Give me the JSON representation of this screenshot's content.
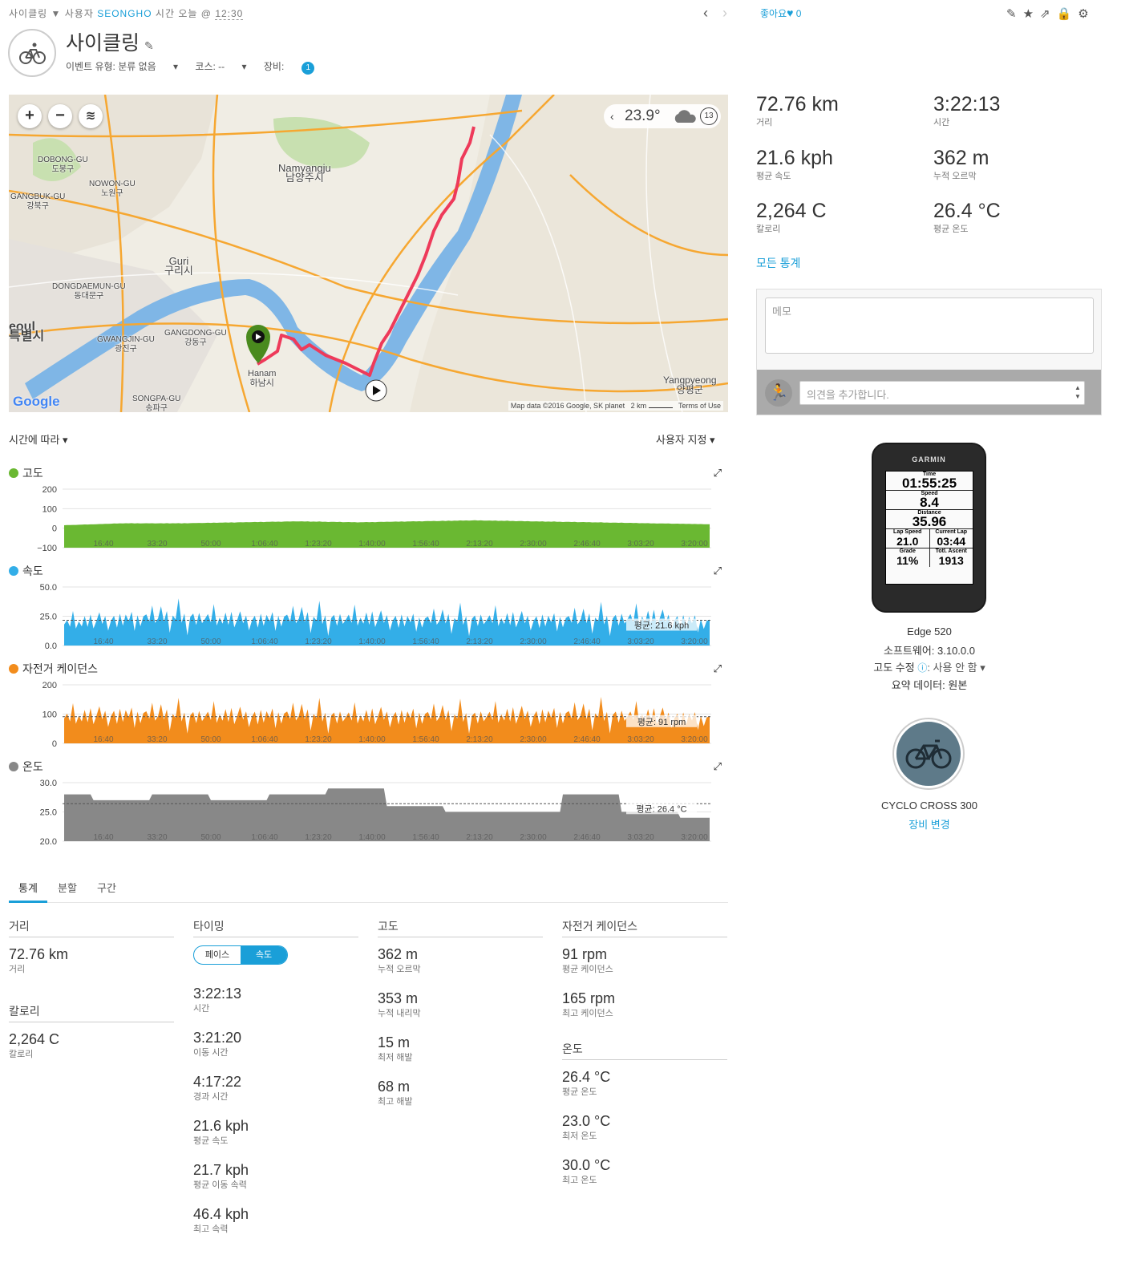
{
  "breadcrumb": {
    "section": "사이클링",
    "arrow": "▼",
    "by": "사용자",
    "user": "SEONGHO",
    "time_prefix": "시간",
    "day": "오늘",
    "at": "@",
    "time": "12:30"
  },
  "activity": {
    "title": "사이클링",
    "event_type": "이벤트 유형: 분류 없음",
    "course": "코스: --",
    "gear_label": "장비:",
    "gear_count": "1"
  },
  "social": {
    "like_label": "좋아요",
    "like_count": "0"
  },
  "map": {
    "temperature": "23.9°",
    "weather_icon": "cloud-icon",
    "wind": "13",
    "attribution": "Map data ©2016 Google, SK planet",
    "scale": "2 km",
    "terms": "Terms of Use",
    "logo": "Google",
    "labels": [
      {
        "en": "Namyangju",
        "ko": "남양주시"
      },
      {
        "en": "Guri",
        "ko": "구리시"
      },
      {
        "en": "DOBONG-GU",
        "ko": "도봉구"
      },
      {
        "en": "NOWON-GU",
        "ko": "노원구"
      },
      {
        "en": "GANGBUK-GU",
        "ko": "강북구"
      },
      {
        "en": "DONGDAEMUN-GU",
        "ko": "동대문구"
      },
      {
        "en": "GWANGJIN-GU",
        "ko": "광진구"
      },
      {
        "en": "GANGDONG-GU",
        "ko": "강동구"
      },
      {
        "en": "Hanam",
        "ko": "하남시"
      },
      {
        "en": "SONGPA-GU",
        "ko": "송파구"
      },
      {
        "en": "Yangpyeong",
        "ko": "양평군"
      },
      {
        "en": "eoul",
        "ko": "특별시"
      }
    ]
  },
  "controls": {
    "x_axis": "시간에 따라",
    "custom": "사용자 지정"
  },
  "charts": [
    {
      "name": "고도",
      "color": "#6ab832",
      "yticks": [
        "200",
        "100",
        "0",
        "−100"
      ],
      "avg_label": ""
    },
    {
      "name": "속도",
      "color": "#33aee8",
      "yticks": [
        "50.0",
        "25.0",
        "0.0"
      ],
      "avg_label": "평균: 21.6 kph"
    },
    {
      "name": "자전거 케이던스",
      "color": "#f28c1c",
      "yticks": [
        "200",
        "100",
        "0"
      ],
      "avg_label": "평균: 91 rpm"
    },
    {
      "name": "온도",
      "color": "#888888",
      "yticks": [
        "30.0",
        "25.0",
        "20.0"
      ],
      "avg_label": "평균: 26.4 °C"
    }
  ],
  "chart_data": [
    {
      "type": "area",
      "title": "고도",
      "x": [
        "16:40",
        "33:20",
        "50:00",
        "1:06:40",
        "1:23:20",
        "1:40:00",
        "1:56:40",
        "2:13:20",
        "2:30:00",
        "2:46:40",
        "3:03:20",
        "3:20:00"
      ],
      "ylim": [
        -100,
        200
      ],
      "series": [
        {
          "values": [
            15,
            25,
            25,
            30,
            35,
            30,
            35,
            40,
            35,
            30,
            25,
            20
          ]
        }
      ]
    },
    {
      "type": "area",
      "title": "속도",
      "x": [
        "16:40",
        "33:20",
        "50:00",
        "1:06:40",
        "1:23:20",
        "1:40:00",
        "1:56:40",
        "2:13:20",
        "2:30:00",
        "2:46:40",
        "3:03:20",
        "3:20:00"
      ],
      "ylim": [
        0,
        50
      ],
      "average": 21.6,
      "series": [
        {
          "values": [
            18,
            22,
            24,
            21,
            23,
            22,
            21,
            22,
            21,
            22,
            23,
            19
          ]
        }
      ]
    },
    {
      "type": "area",
      "title": "자전거 케이던스",
      "x": [
        "16:40",
        "33:20",
        "50:00",
        "1:06:40",
        "1:23:20",
        "1:40:00",
        "1:56:40",
        "2:13:20",
        "2:30:00",
        "2:46:40",
        "3:03:20",
        "3:20:00"
      ],
      "ylim": [
        0,
        200
      ],
      "average": 91,
      "series": [
        {
          "values": [
            85,
            95,
            92,
            90,
            94,
            88,
            92,
            90,
            93,
            95,
            90,
            80
          ]
        }
      ]
    },
    {
      "type": "area",
      "title": "온도",
      "x": [
        "16:40",
        "33:20",
        "50:00",
        "1:06:40",
        "1:23:20",
        "1:40:00",
        "1:56:40",
        "2:13:20",
        "2:30:00",
        "2:46:40",
        "3:03:20",
        "3:20:00"
      ],
      "ylim": [
        20,
        30
      ],
      "average": 26.4,
      "series": [
        {
          "values": [
            28,
            27,
            28,
            27,
            28,
            29,
            26,
            25,
            25,
            28,
            25,
            24
          ]
        }
      ]
    }
  ],
  "stats_tabs": [
    "통계",
    "분할",
    "구간"
  ],
  "stats": {
    "distance": {
      "header": "거리",
      "value": "72.76 km",
      "label": "거리"
    },
    "calories": {
      "header": "칼로리",
      "value": "2,264 C",
      "label": "칼로리"
    },
    "timing": {
      "header": "타이밍",
      "toggle_pace": "페이스",
      "toggle_speed": "속도",
      "items": [
        {
          "value": "3:22:13",
          "label": "시간"
        },
        {
          "value": "3:21:20",
          "label": "이동 시간"
        },
        {
          "value": "4:17:22",
          "label": "경과 시간"
        },
        {
          "value": "21.6 kph",
          "label": "평균 속도"
        },
        {
          "value": "21.7 kph",
          "label": "평균 이동 속력"
        },
        {
          "value": "46.4 kph",
          "label": "최고 속력"
        }
      ]
    },
    "elevation": {
      "header": "고도",
      "items": [
        {
          "value": "362 m",
          "label": "누적 오르막"
        },
        {
          "value": "353 m",
          "label": "누적 내리막"
        },
        {
          "value": "15 m",
          "label": "최저 해발"
        },
        {
          "value": "68 m",
          "label": "최고 해발"
        }
      ]
    },
    "cadence": {
      "header": "자전거 케이던스",
      "items": [
        {
          "value": "91 rpm",
          "label": "평균 케이던스"
        },
        {
          "value": "165 rpm",
          "label": "최고 케이던스"
        }
      ]
    },
    "temperature": {
      "header": "온도",
      "items": [
        {
          "value": "26.4 °C",
          "label": "평균 온도"
        },
        {
          "value": "23.0 °C",
          "label": "최저 온도"
        },
        {
          "value": "30.0 °C",
          "label": "최고 온도"
        }
      ]
    }
  },
  "summary": [
    {
      "value": "72.76 km",
      "label": "거리"
    },
    {
      "value": "3:22:13",
      "label": "시간"
    },
    {
      "value": "21.6 kph",
      "label": "평균 속도"
    },
    {
      "value": "362 m",
      "label": "누적 오르막"
    },
    {
      "value": "2,264 C",
      "label": "칼로리"
    },
    {
      "value": "26.4 °C",
      "label": "평균 온도"
    }
  ],
  "all_stats_link": "모든 통계",
  "memo_placeholder": "메모",
  "comment_placeholder": "의견을 추가합니다.",
  "device": {
    "brand": "GARMIN",
    "name": "Edge 520",
    "software": "소프트웨어: 3.10.0.0",
    "elev_corr_label": "고도 수정",
    "elev_corr_value": ": 사용 안 함",
    "summary_data": "요약 데이터: 원본",
    "screen": {
      "time_label": "Time",
      "time": "01:55:25",
      "speed_label": "Speed",
      "speed": "8.4",
      "dist_label": "Distance",
      "dist": "35.96",
      "lap_speed_label": "Lap Speed",
      "lap_speed": "21.0",
      "cur_lap_label": "Current Lap",
      "cur_lap": "03:44",
      "grade_label": "Grade",
      "grade": "11%",
      "ascent_label": "Totl. Ascent",
      "ascent": "1913"
    }
  },
  "gear": {
    "name": "CYCLO CROSS 300",
    "change_link": "장비 변경"
  }
}
